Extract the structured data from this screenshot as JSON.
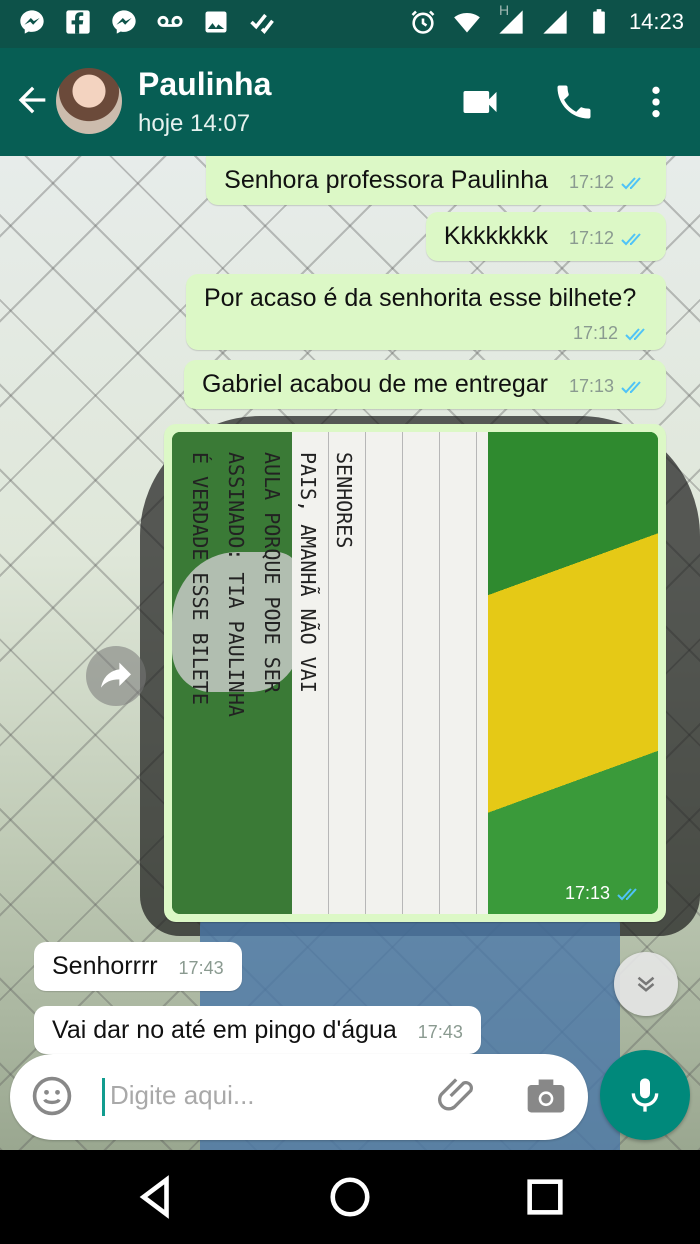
{
  "status_bar": {
    "time": "14:23",
    "icons_left": [
      "messenger-icon",
      "facebook-icon",
      "messenger-icon",
      "voicemail-icon",
      "image-icon",
      "checklist-icon"
    ],
    "icons_right": [
      "alarm-icon",
      "wifi-icon",
      "h-signal-icon",
      "signal-icon",
      "battery-icon"
    ],
    "network_letter": "H"
  },
  "header": {
    "contact_name": "Paulinha",
    "last_seen": "hoje 14:07",
    "accent_color": "#075e54"
  },
  "messages": [
    {
      "direction": "out",
      "text": "Senhora professora Paulinha",
      "time": "17:12",
      "status": "read"
    },
    {
      "direction": "out",
      "text": "Kkkkkkkk",
      "time": "17:12",
      "status": "read"
    },
    {
      "direction": "out",
      "text": "Por acaso é da senhorita esse bilhete?",
      "time": "17:12",
      "status": "read"
    },
    {
      "direction": "out",
      "text": "Gabriel acabou de me entregar",
      "time": "17:13",
      "status": "read"
    },
    {
      "direction": "out",
      "type": "image",
      "time": "17:13",
      "status": "read",
      "image_text": "SENHORES\nPAIS, AMANHÃ NÃO VAI\nAULA PORQUE PODE SER\nASSINADO: TIA PAULINHA\nÉ VERDADE ESSE BILETE"
    },
    {
      "direction": "in",
      "text": "Senhorrrr",
      "time": "17:43"
    },
    {
      "direction": "in",
      "text": "Vai dar no até em pingo d'água",
      "time": "17:43"
    }
  ],
  "input": {
    "placeholder": "Digite aqui..."
  },
  "colors": {
    "outgoing_bubble": "#dcf8c6",
    "incoming_bubble": "#ffffff",
    "read_tick": "#4fc3f7",
    "fab": "#00897b"
  }
}
